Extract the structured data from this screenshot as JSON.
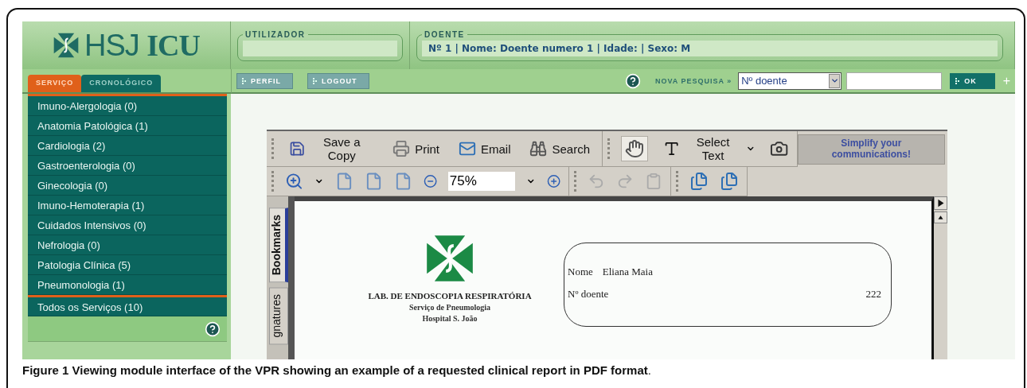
{
  "header": {
    "logo": {
      "light": "HSJ",
      "bold": "ICU"
    },
    "user_panel": {
      "label": "UTILIZADOR"
    },
    "patient_panel": {
      "label": "DOENTE",
      "info": "Nº 1 | Nome: Doente numero 1 | Idade: | Sexo: M"
    }
  },
  "sidebar": {
    "tabs": [
      {
        "label": "SERVIÇO",
        "selected": true
      },
      {
        "label": "CRONOLÓGICO",
        "selected": false
      }
    ],
    "items": [
      {
        "label": "Imuno-Alergologia (0)"
      },
      {
        "label": "Anatomia Patológica (1)"
      },
      {
        "label": "Cardiologia (2)"
      },
      {
        "label": "Gastroenterologia (0)"
      },
      {
        "label": "Ginecologia (0)"
      },
      {
        "label": "Imuno-Hemoterapia (1)"
      },
      {
        "label": "Cuidados Intensivos (0)"
      },
      {
        "label": "Nefrologia (0)"
      },
      {
        "label": "Patologia Clínica (5)"
      },
      {
        "label": "Pneumonologia (1)"
      }
    ],
    "total": "Todos os Serviços (10)"
  },
  "actions": [
    "PERFIL",
    "LOGOUT"
  ],
  "search": {
    "label": "NOVA PESQUISA »",
    "field_type": "Nº doente",
    "button": "OK",
    "add": "+"
  },
  "pdf_viewer": {
    "toolbar": [
      {
        "kind": "save",
        "label": "Save a Copy"
      },
      {
        "kind": "print",
        "label": "Print"
      },
      {
        "kind": "email",
        "label": "Email"
      },
      {
        "kind": "search",
        "label": "Search"
      }
    ],
    "tools": [
      {
        "kind": "hand",
        "selected": true
      },
      {
        "kind": "select",
        "label": "Select Text",
        "selected": false
      }
    ],
    "ad": "Simplify your communications!",
    "zoom": "75%",
    "side_tabs": [
      {
        "label": "Bookmarks",
        "selected": true
      },
      {
        "label": "gnatures",
        "selected": false
      }
    ],
    "document": {
      "lab": "LAB. DE ENDOSCOPIA RESPIRATÓRIA",
      "service": "Serviço de Pneumologia",
      "hospital": "Hospital S. João",
      "fields": [
        {
          "label": "Nome",
          "value": "Eliana Maia"
        },
        {
          "label": "Nº doente",
          "value": "222"
        }
      ]
    }
  },
  "caption": "**Figure 1 Viewing module interface of the VPR showing an example of a requested clinical report in PDF format**."
}
